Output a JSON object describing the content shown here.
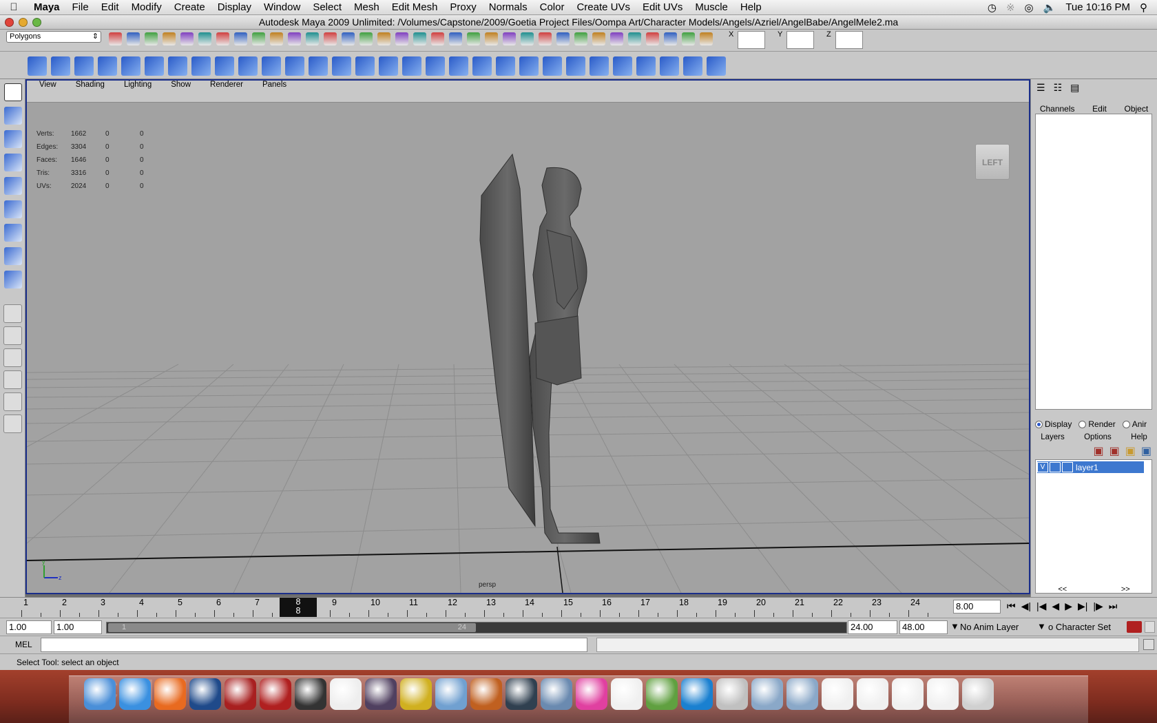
{
  "mac_menubar": {
    "app": "Maya",
    "items": [
      "File",
      "Edit",
      "Modify",
      "Create",
      "Display",
      "Window",
      "Select",
      "Mesh",
      "Edit Mesh",
      "Proxy",
      "Normals",
      "Color",
      "Create UVs",
      "Edit UVs",
      "Muscle",
      "Help"
    ],
    "clock": "Tue 10:16 PM"
  },
  "window": {
    "title": "Autodesk Maya 2009 Unlimited: /Volumes/Capstone/2009/Goetia Project Files/Oompa Art/Character Models/Angels/Azriel/AngelBabe/AngelMele2.ma"
  },
  "statusline": {
    "menuset": "Polygons",
    "x_label": "X",
    "y_label": "Y",
    "z_label": "Z"
  },
  "panel": {
    "menus": [
      "View",
      "Shading",
      "Lighting",
      "Show",
      "Renderer",
      "Panels"
    ],
    "camera": "persp",
    "viewcube": "LEFT"
  },
  "hud": [
    {
      "label": "Verts:",
      "v1": "1662",
      "v2": "0",
      "v3": "0"
    },
    {
      "label": "Edges:",
      "v1": "3304",
      "v2": "0",
      "v3": "0"
    },
    {
      "label": "Faces:",
      "v1": "1646",
      "v2": "0",
      "v3": "0"
    },
    {
      "label": "Tris:",
      "v1": "3316",
      "v2": "0",
      "v3": "0"
    },
    {
      "label": "UVs:",
      "v1": "2024",
      "v2": "0",
      "v3": "0"
    }
  ],
  "channelbox": {
    "tabs": [
      "Channels",
      "Edit",
      "Object"
    ],
    "layer_radios": [
      "Display",
      "Render",
      "Anir"
    ],
    "layer_menus": [
      "Layers",
      "Options",
      "Help"
    ],
    "layer": {
      "visible": "V",
      "name": "layer1"
    },
    "nav_left": "<<",
    "nav_right": ">>"
  },
  "timeline": {
    "frames": [
      "1",
      "2",
      "3",
      "4",
      "5",
      "6",
      "7",
      "8",
      "9",
      "10",
      "11",
      "12",
      "13",
      "14",
      "15",
      "16",
      "17",
      "18",
      "19",
      "20",
      "21",
      "22",
      "23",
      "24"
    ],
    "current": "8",
    "current_field": "8.00"
  },
  "range": {
    "start": "1.00",
    "start2": "1.00",
    "slider_start": "1",
    "slider_end": "24",
    "end": "24.00",
    "end2": "48.00",
    "anim_layer": "No Anim Layer",
    "char_set": "o Character Set"
  },
  "mel": {
    "label": "MEL"
  },
  "helpline": "Select Tool: select an object",
  "dock": {
    "icons": [
      "finder-icon",
      "safari-icon",
      "firefox-icon",
      "photoshop-icon",
      "maya-icon",
      "flash-icon",
      "unity-icon",
      "script-editor-icon",
      "warcraft-icon",
      "imovie-icon",
      "itunes-icon",
      "garageband-icon",
      "textwrangler-icon",
      "preview-icon",
      "color-picker-icon",
      "textedit-icon",
      "lotus-icon",
      "quicktime-icon",
      "mail-icon",
      "folder-icon",
      "downloads-icon",
      "window1-icon",
      "window2-icon",
      "window3-icon",
      "window4-icon",
      "trash-icon"
    ]
  }
}
